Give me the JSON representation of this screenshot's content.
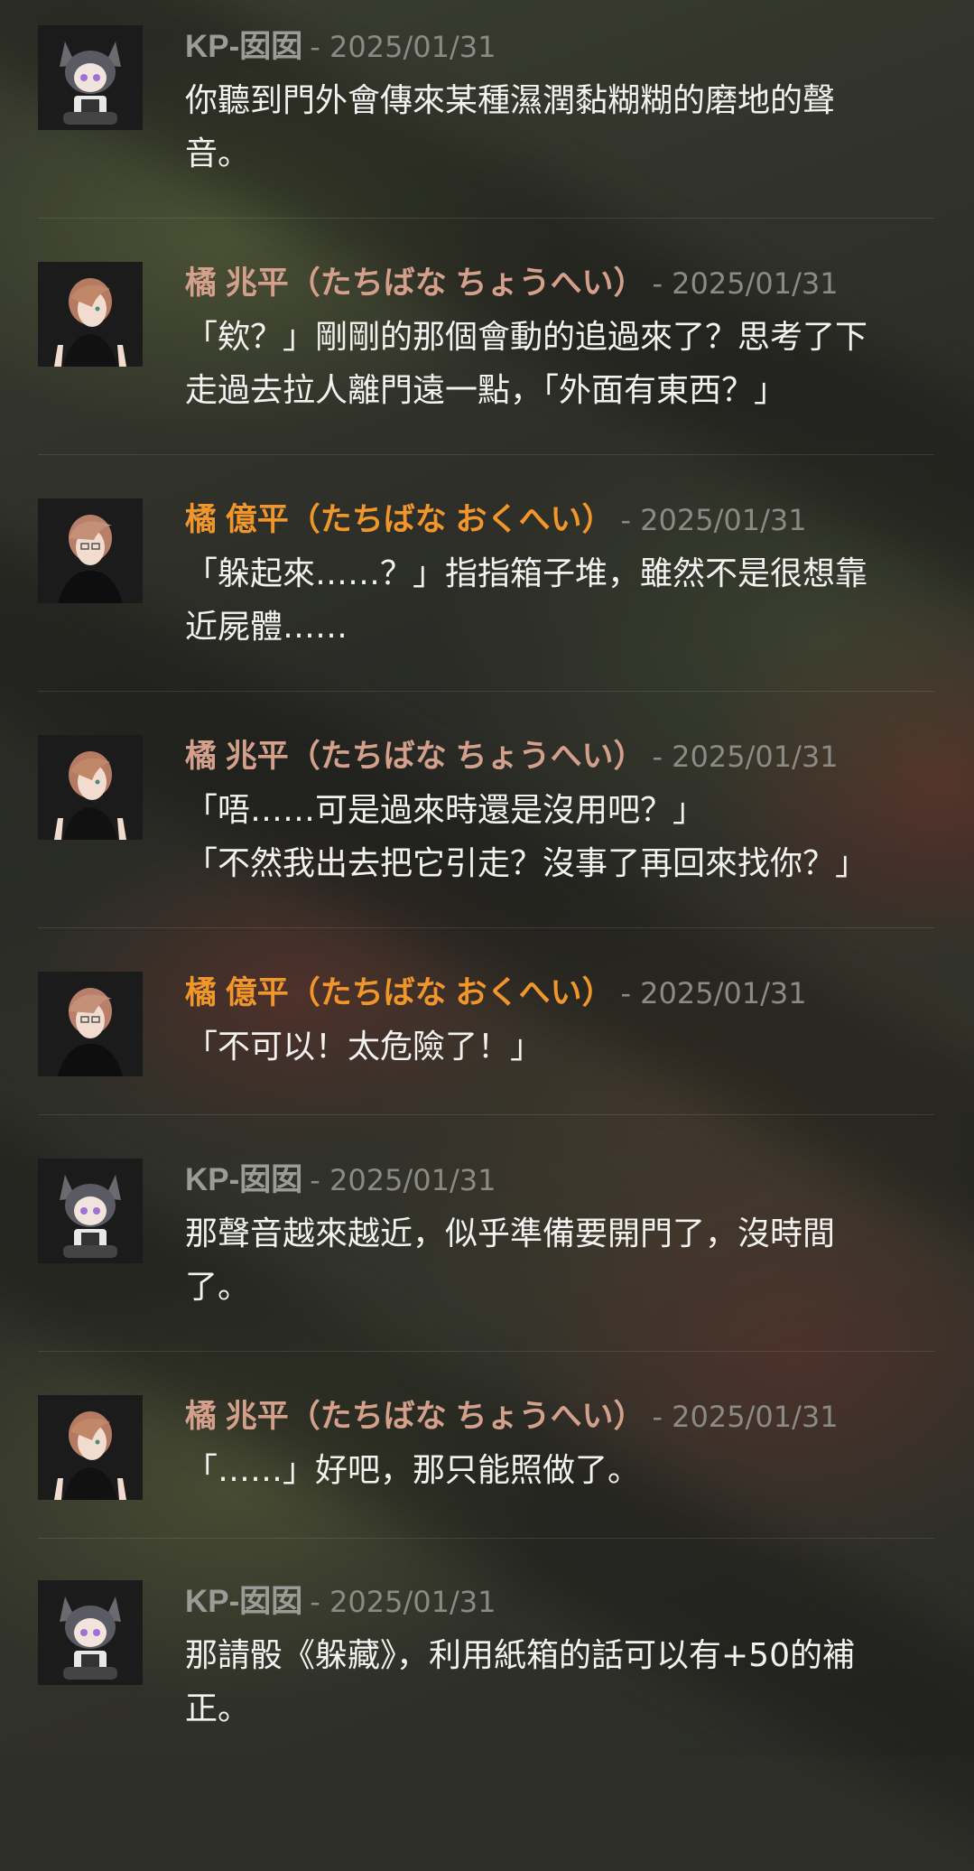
{
  "messages": [
    {
      "avatar": "cat-ear-girl-avatar",
      "name": "KP-囡囡",
      "date": "- 2025/01/31",
      "lines": [
        "你聽到門外會傳來某種濕潤黏糊糊的磨地的聲",
        "音。"
      ]
    },
    {
      "avatar": "chouhei-avatar",
      "name": "橘 兆平（たちばな ちょうへい）",
      "date": "- 2025/01/31",
      "lines": [
        "「欸？」剛剛的那個會動的追過來了？思考了下",
        "走過去拉人離門遠一點，「外面有東西？」"
      ]
    },
    {
      "avatar": "okuhei-avatar",
      "name": "橘 億平（たちばな おくへい）",
      "date": "- 2025/01/31",
      "lines": [
        "「躲起來……？」指指箱子堆，雖然不是很想靠",
        "近屍體……"
      ]
    },
    {
      "avatar": "chouhei-avatar",
      "name": "橘 兆平（たちばな ちょうへい）",
      "date": "- 2025/01/31",
      "lines": [
        "「唔……可是過來時還是沒用吧？」",
        "「不然我出去把它引走？沒事了再回來找你？」"
      ]
    },
    {
      "avatar": "okuhei-avatar",
      "name": "橘 億平（たちばな おくへい）",
      "date": "- 2025/01/31",
      "lines": [
        "「不可以！太危險了！」"
      ]
    },
    {
      "avatar": "cat-ear-girl-avatar",
      "name": "KP-囡囡",
      "date": "- 2025/01/31",
      "lines": [
        "那聲音越來越近，似乎準備要開門了，沒時間",
        "了。"
      ]
    },
    {
      "avatar": "chouhei-avatar",
      "name": "橘 兆平（たちばな ちょうへい）",
      "date": "- 2025/01/31",
      "lines": [
        "「……」好吧，那只能照做了。"
      ]
    },
    {
      "avatar": "cat-ear-girl-avatar",
      "name": "KP-囡囡",
      "date": "- 2025/01/31",
      "lines": [
        "那請骰《躲藏》，利用紙箱的話可以有+50的補",
        "正。"
      ]
    }
  ],
  "colors": {
    "kp_name": "#9b9b97",
    "chouhei_name": "#d4a08c",
    "okuhei_name": "#f0962a",
    "date": "#8a8a86",
    "text": "#f2f2f0"
  }
}
